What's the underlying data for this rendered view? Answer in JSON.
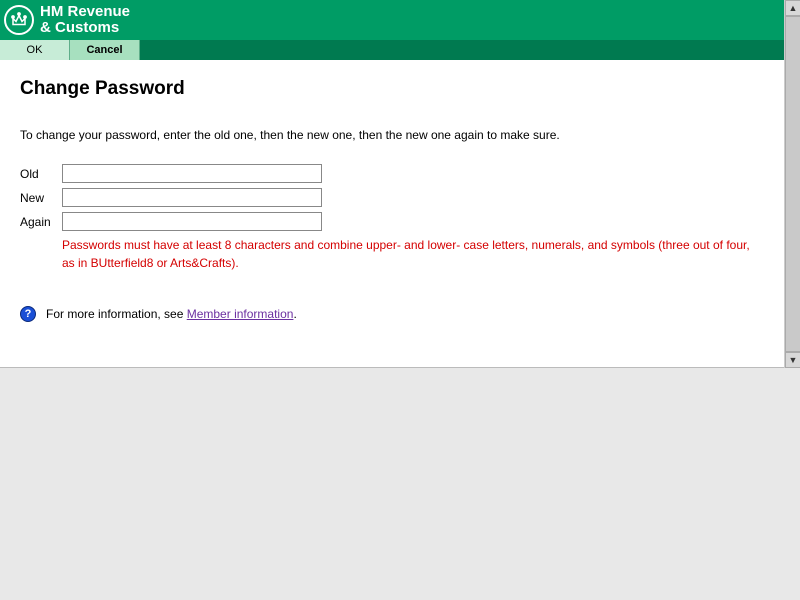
{
  "brand": {
    "line1": "HM Revenue",
    "line2": "& Customs"
  },
  "toolbar": {
    "ok": "OK",
    "cancel": "Cancel"
  },
  "page": {
    "title": "Change Password",
    "instruction": "To change your password, enter the old one, then the new one, then the new one again to make sure."
  },
  "fields": {
    "old": {
      "label": "Old",
      "value": ""
    },
    "new": {
      "label": "New",
      "value": ""
    },
    "again": {
      "label": "Again",
      "value": ""
    }
  },
  "hint": "Passwords must have at least 8 characters and combine upper- and lower- case letters, numerals, and symbols (three out of four, as in BUtterfield8 or Arts&Crafts).",
  "info": {
    "prefix": "For more information, see ",
    "link_text": "Member information",
    "suffix": "."
  },
  "colors": {
    "brand_green": "#009C65",
    "error_red": "#d40000",
    "link_purple": "#6b2fa0"
  }
}
